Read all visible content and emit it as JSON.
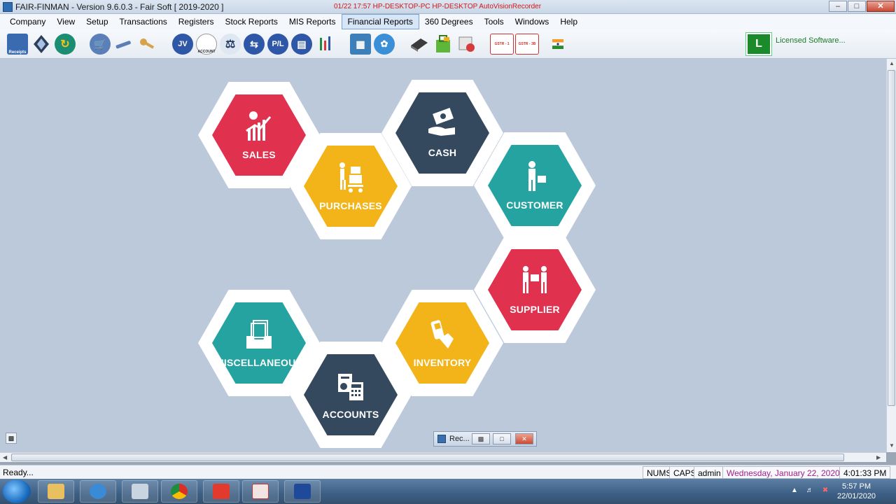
{
  "window": {
    "title": "FAIR-FINMAN - Version 9.6.0.3 - Fair Soft [ 2019-2020 ]",
    "recorder_overlay": "01/22 17:57 HP-DESKTOP-PC HP-DESKTOP AutoVisionRecorder"
  },
  "menu": [
    {
      "label": "Company"
    },
    {
      "label": "View"
    },
    {
      "label": "Setup"
    },
    {
      "label": "Transactions"
    },
    {
      "label": "Registers"
    },
    {
      "label": "Stock Reports"
    },
    {
      "label": "MIS Reports"
    },
    {
      "label": "Financial Reports",
      "active": true
    },
    {
      "label": "360 Degrees"
    },
    {
      "label": "Tools"
    },
    {
      "label": "Windows"
    },
    {
      "label": "Help"
    }
  ],
  "toolbar": {
    "receipts_label": "Receipts",
    "jv_label": "JV",
    "account_label": "ACCOUNT",
    "pl_label": "P/L",
    "gstr1_label": "GSTR - 1",
    "gstr3b_label": "GSTR - 3B",
    "license_badge": "L",
    "license_text": "Licensed Software...",
    "icons": [
      "receipts-icon",
      "diamond-icon",
      "refresh-icon",
      "cart-icon",
      "tools-icon",
      "key-icon",
      "jv-icon",
      "account-icon",
      "balance-scale-icon",
      "transfer-icon",
      "pl-icon",
      "document-icon",
      "chart-icon",
      "calculator-icon",
      "group-icon",
      "book-icon",
      "shopping-bag-icon",
      "calendar-icon",
      "gstr1-icon",
      "gstr3b-icon",
      "india-flag-icon"
    ]
  },
  "hexes": {
    "sales": {
      "label": "SALES",
      "color": "#e0314e"
    },
    "purchases": {
      "label": "PURCHASES",
      "color": "#f2b418"
    },
    "cash": {
      "label": "CASH",
      "color": "#34485e"
    },
    "customer": {
      "label": "CUSTOMER",
      "color": "#25a3a0"
    },
    "supplier": {
      "label": "SUPPLIER",
      "color": "#e0314e"
    },
    "inventory": {
      "label": "INVENTORY",
      "color": "#f2b418"
    },
    "miscellaneous": {
      "label": "MISCELLANEOUS",
      "color": "#25a3a0"
    },
    "accounts": {
      "label": "ACCOUNTS",
      "color": "#34485e"
    }
  },
  "mini_window": {
    "title": "Rec..."
  },
  "status": {
    "ready": "Ready...",
    "nums": "NUMS",
    "caps": "CAPS",
    "user": "admin",
    "date": "Wednesday, January 22, 2020",
    "time": "4:01:33 PM"
  },
  "taskbar": {
    "clock_time": "5:57 PM",
    "clock_date": "22/01/2020",
    "apps": [
      "explorer-icon",
      "internet-explorer-icon",
      "calculator-icon",
      "chrome-icon",
      "anydesk-icon",
      "finman-icon",
      "recorder-icon"
    ]
  }
}
